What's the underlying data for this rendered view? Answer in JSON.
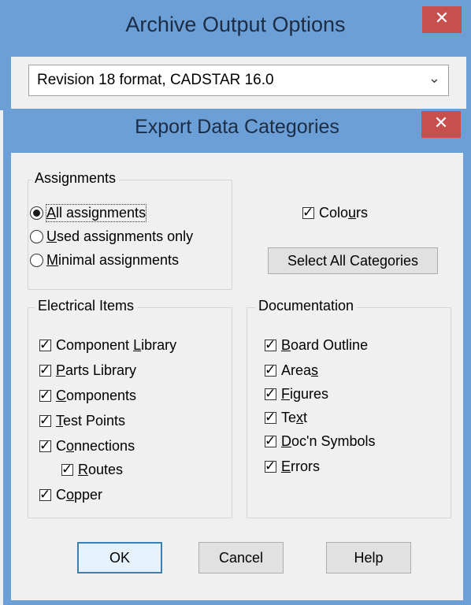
{
  "archive_window": {
    "title": "Archive Output Options",
    "format_value": "Revision 18 format, CADSTAR 16.0"
  },
  "export_dialog": {
    "title": "Export Data Categories",
    "assignments": {
      "label": "Assignments",
      "options": [
        {
          "label": "All assignments",
          "selected": true
        },
        {
          "label": "Used assignments only",
          "selected": false
        },
        {
          "label": "Minimal assignments",
          "selected": false
        }
      ]
    },
    "colours_label": "Colours",
    "colours_checked": true,
    "select_all_label": "Select All Categories",
    "electrical": {
      "label": "Electrical Items",
      "items": [
        {
          "label": "Component Library",
          "checked": true
        },
        {
          "label": "Parts Library",
          "checked": true
        },
        {
          "label": "Components",
          "checked": true
        },
        {
          "label": "Test Points",
          "checked": true
        },
        {
          "label": "Connections",
          "checked": true
        },
        {
          "label": "Routes",
          "checked": true
        },
        {
          "label": "Copper",
          "checked": true
        }
      ]
    },
    "documentation": {
      "label": "Documentation",
      "items": [
        {
          "label": "Board Outline",
          "checked": true
        },
        {
          "label": "Areas",
          "checked": true
        },
        {
          "label": "Figures",
          "checked": true
        },
        {
          "label": "Text",
          "checked": true
        },
        {
          "label": "Doc'n Symbols",
          "checked": true
        },
        {
          "label": "Errors",
          "checked": true
        }
      ]
    },
    "buttons": {
      "ok": "OK",
      "cancel": "Cancel",
      "help": "Help"
    }
  },
  "icons": {
    "close": "close-icon",
    "chevron": "chevron-down-icon",
    "check": "check-icon"
  },
  "colors": {
    "titlebar": "#6b9fd6",
    "close": "#c7504f",
    "client": "#f0f0f0"
  }
}
